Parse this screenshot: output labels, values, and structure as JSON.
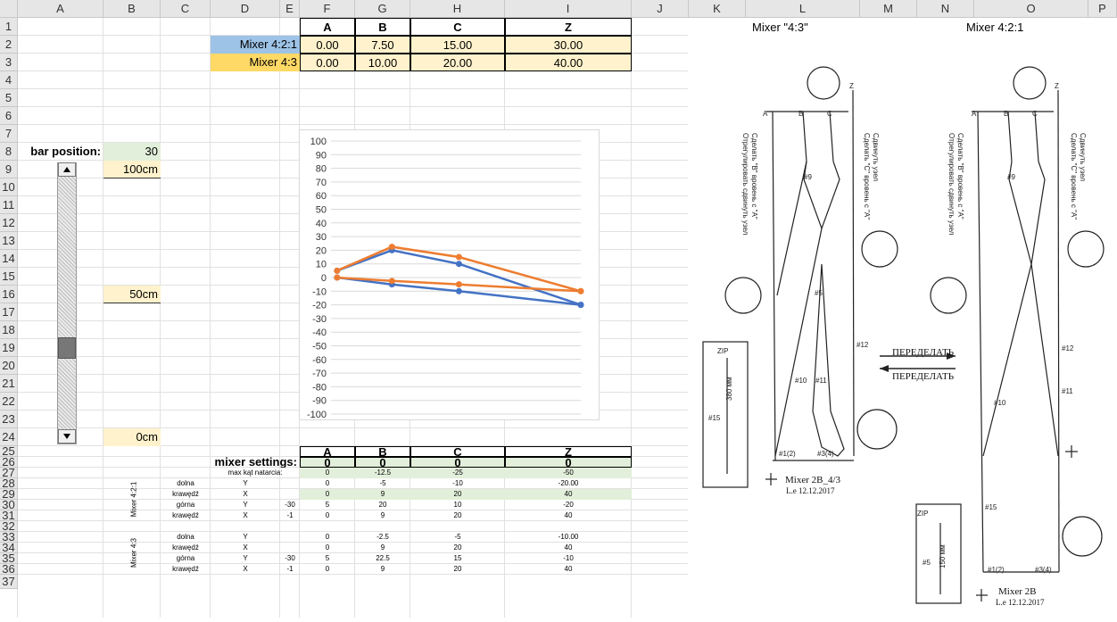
{
  "columns": [
    "A",
    "B",
    "C",
    "D",
    "E",
    "F",
    "G",
    "H",
    "I",
    "J",
    "K",
    "L",
    "M",
    "N",
    "O",
    "P"
  ],
  "rows": [
    "1",
    "2",
    "3",
    "4",
    "5",
    "6",
    "7",
    "8",
    "9",
    "10",
    "11",
    "12",
    "13",
    "14",
    "15",
    "16",
    "17",
    "18",
    "19",
    "20",
    "21",
    "22",
    "23",
    "24",
    "25",
    "26",
    "27",
    "28",
    "29",
    "30",
    "31",
    "32",
    "33",
    "34",
    "35",
    "36",
    "37"
  ],
  "colors": {
    "blue_fill": "#9dc3e6",
    "gold_fill": "#ffd966",
    "peach_fill": "#fff2cc",
    "green_fill": "#e2efda",
    "series1": "#4472c4",
    "series2": "#ed7d31"
  },
  "top_table": {
    "headers": [
      "A",
      "B",
      "C",
      "Z"
    ],
    "rows": [
      {
        "label": "Mixer 4:2:1",
        "values": [
          "0.00",
          "7.50",
          "15.00",
          "30.00"
        ]
      },
      {
        "label": "Mixer 4:3",
        "values": [
          "0.00",
          "10.00",
          "20.00",
          "40.00"
        ]
      }
    ]
  },
  "bar": {
    "label": "bar position:",
    "value": "30",
    "mark_100": "100cm",
    "mark_50": "50cm",
    "mark_0": "0cm"
  },
  "settings": {
    "headers": [
      "A",
      "B",
      "C",
      "Z"
    ],
    "label": "mixer settings:",
    "values": [
      "0",
      "0",
      "0",
      "0"
    ],
    "row27": {
      "label": "max kąt natarcia:",
      "values": [
        "0",
        "-12.5",
        "-25",
        "-50"
      ]
    }
  },
  "mixer421": {
    "group": "Mixer 4:2:1",
    "rows": [
      {
        "name": "dolna",
        "axis": "Y",
        "e": "",
        "vals": [
          "0",
          "-5",
          "-10",
          "-20.00"
        ]
      },
      {
        "name": "krawędź",
        "axis": "X",
        "e": "",
        "vals": [
          "0",
          "9",
          "20",
          "40"
        ]
      },
      {
        "name": "górna",
        "axis": "Y",
        "e": "-30",
        "vals": [
          "5",
          "20",
          "10",
          "-20"
        ]
      },
      {
        "name": "krawędź",
        "axis": "X",
        "e": "-1",
        "vals": [
          "0",
          "9",
          "20",
          "40"
        ]
      }
    ]
  },
  "mixer43": {
    "group": "Mixer 4:3",
    "rows": [
      {
        "name": "dolna",
        "axis": "Y",
        "e": "",
        "vals": [
          "0",
          "-2.5",
          "-5",
          "-10.00"
        ]
      },
      {
        "name": "krawędź",
        "axis": "X",
        "e": "",
        "vals": [
          "0",
          "9",
          "20",
          "40"
        ]
      },
      {
        "name": "górna",
        "axis": "Y",
        "e": "-30",
        "vals": [
          "5",
          "22.5",
          "15",
          "-10"
        ]
      },
      {
        "name": "krawędź",
        "axis": "X",
        "e": "-1",
        "vals": [
          "0",
          "9",
          "20",
          "40"
        ]
      }
    ]
  },
  "right_headers": {
    "left": "Mixer \"4:3\"",
    "right": "Mixer 4:2:1"
  },
  "drawing": {
    "letters": [
      "A",
      "B",
      "C",
      "Z"
    ],
    "node_labels": [
      "#9",
      "#10",
      "#11",
      "#12",
      "#15",
      "#5",
      "#1(2)",
      "#3(4)"
    ],
    "arrow_top": "ПЕРЕДЕЛАТЬ",
    "arrow_bottom": "ПЕРЕДЕЛАТЬ",
    "zip": "ZIP",
    "zip_len_left": "380 мм",
    "zip_len_right": "150 мм",
    "rot_text_1": "Отрегулировать сдвинуть узел",
    "rot_text_2": "Сделать \"B\" вровень с \"A\"",
    "rot_text_3": "Сдвинуть узел",
    "rot_text_4": "Сделать \"C\" вровень с \"A\"",
    "caption_left": "Mixer 2B_4/3",
    "caption_left_sub": "L.e  12.12.2017",
    "caption_right": "Mixer 2B",
    "caption_right_sub": "L.e  12.12.2017"
  },
  "chart_data": {
    "type": "line",
    "yticks": [
      "100",
      "90",
      "80",
      "70",
      "60",
      "50",
      "40",
      "30",
      "20",
      "10",
      "0",
      "-10",
      "-20",
      "-30",
      "-40",
      "-50",
      "-60",
      "-70",
      "-80",
      "-90",
      "-100"
    ],
    "ylim": [
      -100,
      100
    ],
    "xlim": [
      -1,
      40
    ],
    "series": [
      {
        "color": "#4472c4",
        "upper": [
          {
            "x": 0,
            "y": 5
          },
          {
            "x": 9,
            "y": 20
          },
          {
            "x": 20,
            "y": 10
          },
          {
            "x": 40,
            "y": -20
          }
        ],
        "lower": [
          {
            "x": 0,
            "y": 0
          },
          {
            "x": 9,
            "y": -5
          },
          {
            "x": 20,
            "y": -10
          },
          {
            "x": 40,
            "y": -20
          }
        ]
      },
      {
        "color": "#ed7d31",
        "upper": [
          {
            "x": 0,
            "y": 5
          },
          {
            "x": 9,
            "y": 22.5
          },
          {
            "x": 20,
            "y": 15
          },
          {
            "x": 40,
            "y": -10
          }
        ],
        "lower": [
          {
            "x": 0,
            "y": 0
          },
          {
            "x": 9,
            "y": -2.5
          },
          {
            "x": 20,
            "y": -5
          },
          {
            "x": 40,
            "y": -10
          }
        ]
      }
    ]
  }
}
